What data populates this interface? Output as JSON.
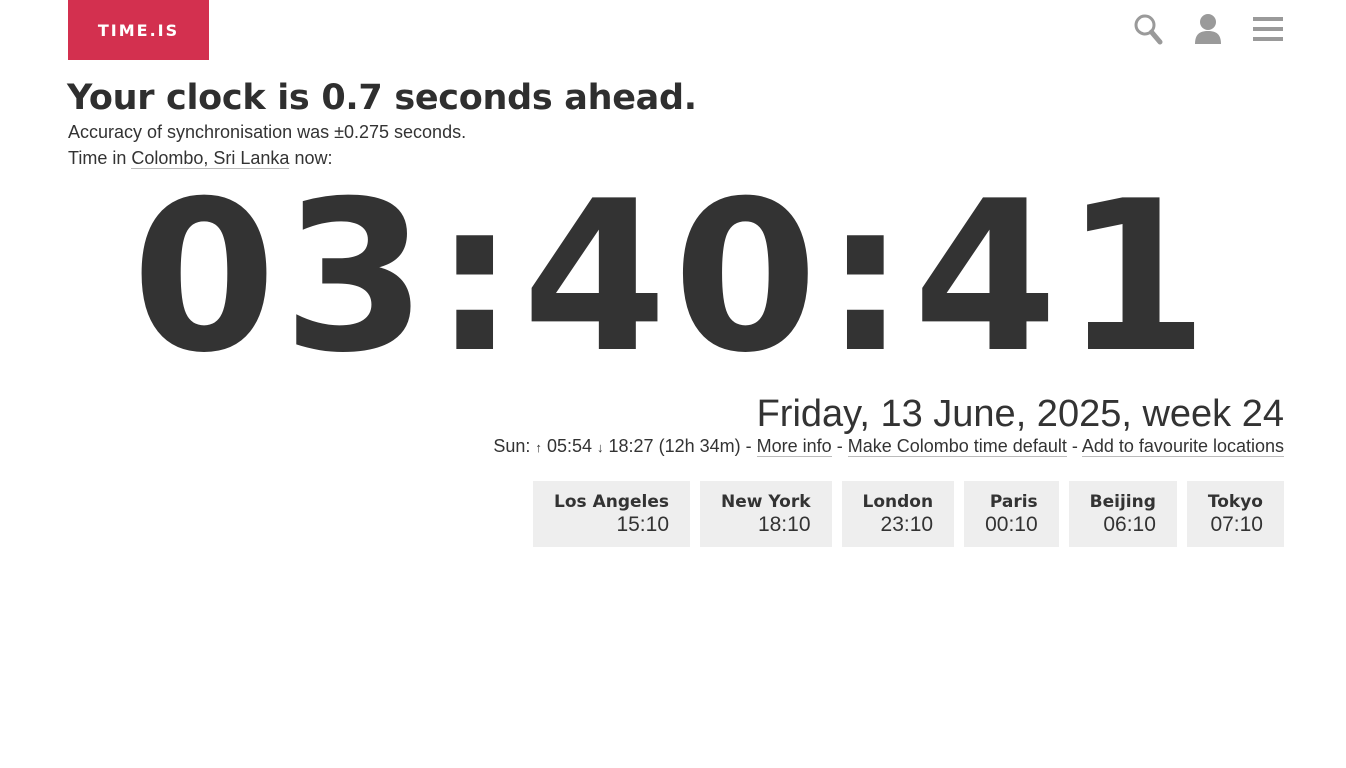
{
  "header": {
    "logo_text": "TIME.IS",
    "icons": [
      "search-icon",
      "user-icon",
      "menu-icon"
    ],
    "brand_color": "#d3304f"
  },
  "status": {
    "headline": "Your clock is 0.7 seconds ahead.",
    "accuracy": "Accuracy of synchronisation was ±0.275 seconds.",
    "time_in_prefix": "Time in",
    "location_link": "Colombo, Sri Lanka",
    "time_in_suffix": "now:"
  },
  "clock": {
    "time": "03:40:41"
  },
  "date": {
    "full": "Friday, 13 June, 2025, week 24"
  },
  "sun": {
    "prefix": "Sun:",
    "sunrise_arrow": "↑",
    "sunrise": "05:54",
    "sunset_arrow": "↓",
    "sunset": "18:27",
    "daylength": "(12h 34m)",
    "sep1": "-",
    "more_info": "More info",
    "sep2": "-",
    "make_default": "Make Colombo time default",
    "sep3": "-",
    "add_favourite": "Add to favourite locations"
  },
  "cities": [
    {
      "name": "Los Angeles",
      "time": "15:10"
    },
    {
      "name": "New York",
      "time": "18:10"
    },
    {
      "name": "London",
      "time": "23:10"
    },
    {
      "name": "Paris",
      "time": "00:10"
    },
    {
      "name": "Beijing",
      "time": "06:10"
    },
    {
      "name": "Tokyo",
      "time": "07:10"
    }
  ]
}
